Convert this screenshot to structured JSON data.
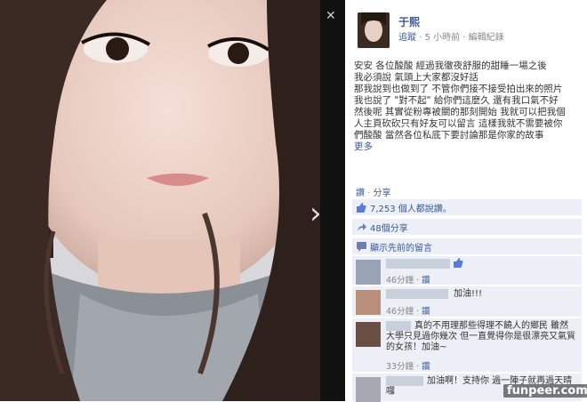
{
  "author": {
    "name": "于熙"
  },
  "meta": {
    "follow_label": "追蹤",
    "time": "5 小時前",
    "edit_history": "編輯紀錄",
    "sep": "·"
  },
  "post": {
    "lines": [
      "安安 各位酸酸 經過我徹夜舒服的甜睡一場之後",
      "我必須說 氣頭上大家都沒好話",
      "那我說到也做到了 不管你們接不接受拍出來的照片",
      "我也說了 \"對不起\" 給你們這麼久 還有我口氣不好",
      "然後呢 其實從粉專被關的那刻開始 我就可以把我個",
      "人主頁砍砍只有好友可以留言 這樣我就不需要被你",
      "們酸酸 當然各位私底下要討論那是你家的故事"
    ],
    "more_label": "更多"
  },
  "actions": {
    "like": "讚",
    "sep": "·",
    "share": "分享"
  },
  "likes": {
    "text": "7,253 個人都說讚。"
  },
  "shares": {
    "text": "48個分享"
  },
  "prev_comments": {
    "text": "顯示先前的留言"
  },
  "comments": [
    {
      "text": "",
      "meta_time": "46分鐘",
      "meta_like": "讚"
    },
    {
      "text": "加油!!!",
      "meta_time": "46分鐘",
      "meta_like": "讚"
    },
    {
      "text": "真的不用理那些得理不饒人的鄉民 雖然大學只見過你幾次 但一直覺得你是很漂亮又氣質的女孩！加油~",
      "meta_time": "33分鐘",
      "meta_like": "讚"
    },
    {
      "text": "加油啊！支持你 過一陣子就再過天晴囉"
    }
  ],
  "watermark": "funpeer.com",
  "colors": {
    "link": "#3b5998",
    "panel_bg": "#eceff5",
    "photo_bg": "#111111"
  },
  "icons": {
    "like": "thumbs-up-icon",
    "share": "share-icon",
    "comments": "speech-bubble-icon",
    "next": "chevron-right-icon"
  }
}
